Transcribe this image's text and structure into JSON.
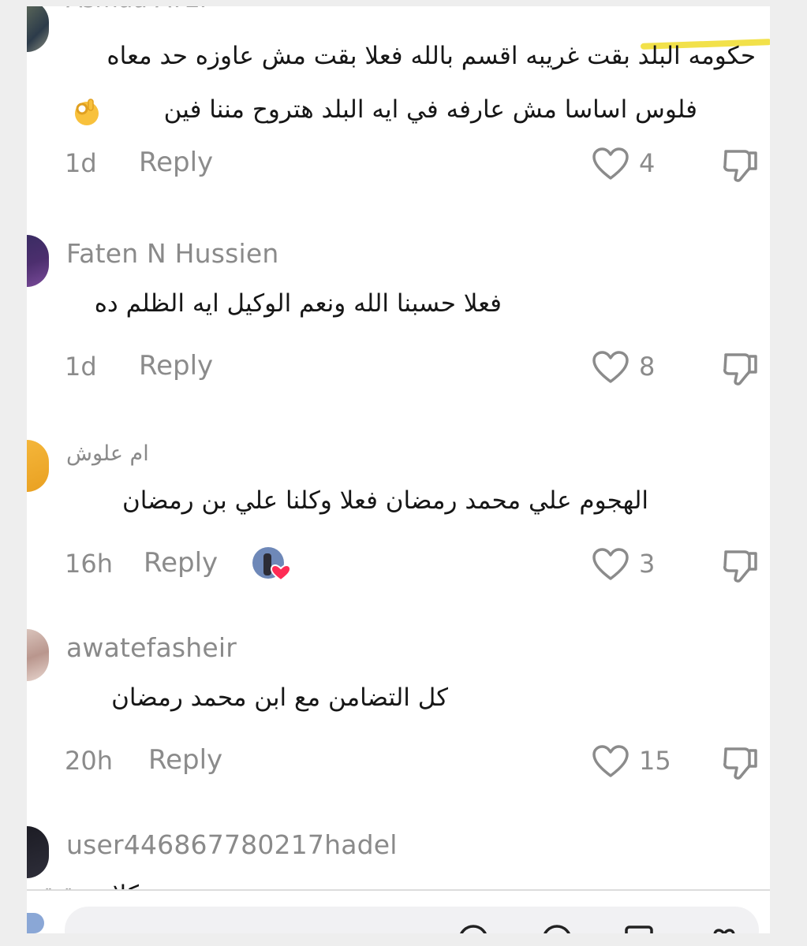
{
  "comments": [
    {
      "username": "Asmaa ATEF",
      "lines": [
        "حكومه البلد بقت غريبه اقسم بالله فعلا بقت مش عاوزه حد معاه",
        "فلوس اساسا مش عارفه في ايه البلد هتروح مننا فين"
      ],
      "emoji": "ok-hand-emoji",
      "time": "1d",
      "reply": "Reply",
      "likes": "4"
    },
    {
      "username": "Faten N Hussien",
      "lines": [
        "فعلا حسبنا الله ونعم الوكيل ايه الظلم ده"
      ],
      "time": "1d",
      "reply": "Reply",
      "likes": "8"
    },
    {
      "username": "ام علوش",
      "lines": [
        "الهجوم علي محمد رمضان فعلا وكلنا علي بن رمضان"
      ],
      "time": "16h",
      "reply": "Reply",
      "likes": "3",
      "creator_liked": true
    },
    {
      "username": "awatefasheir",
      "lines": [
        "كل التضامن مع ابن محمد رمضان"
      ],
      "time": "20h",
      "reply": "Reply",
      "likes": "15"
    },
    {
      "username": "user446867780217hadel",
      "lines": [
        "كلام حقيقة"
      ]
    }
  ],
  "icons": {
    "like": "heart-outline-icon",
    "dislike": "thumbs-down-icon",
    "creator_reaction": "creator-liked-heart-icon"
  },
  "colors": {
    "highlight": "#f2e14a",
    "reaction_heart": "#fe2c55",
    "muted_text": "#8b8b8b"
  }
}
